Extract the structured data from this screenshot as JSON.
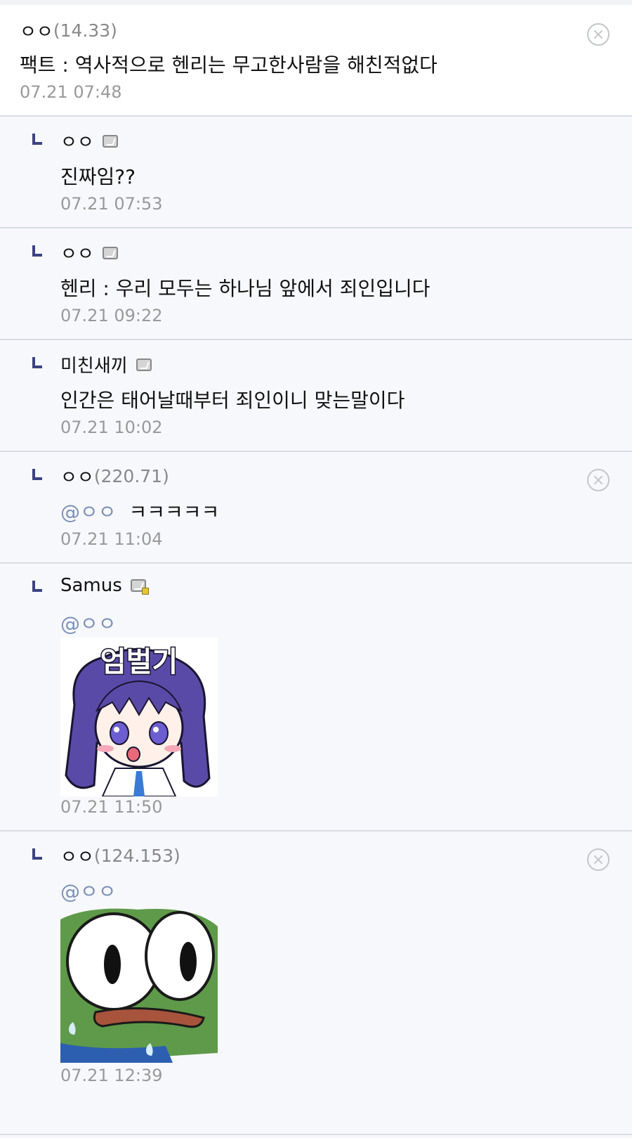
{
  "comments": [
    {
      "nick": "ㅇㅇ",
      "ip": "(14.33)",
      "text": "팩트 : 역사적으로 헨리는 무고한사람을 해친적없다",
      "date": "07.21 07:48"
    },
    {
      "nick": "ㅇㅇ",
      "text": "진짜임??",
      "date": "07.21 07:53"
    },
    {
      "nick": "ㅇㅇ",
      "text": "헨리 : 우리 모두는 하나님 앞에서 죄인입니다",
      "date": "07.21 09:22"
    },
    {
      "nick": "미친새끼",
      "text": "인간은 태어날때부터 죄인이니 맞는말이다",
      "date": "07.21 10:02"
    },
    {
      "nick": "ㅇㅇ",
      "ip": "(220.71)",
      "mention": "@ㅇㅇ",
      "text": "ㅋㅋㅋㅋㅋ",
      "date": "07.21 11:04"
    },
    {
      "nick": "Samus",
      "mention": "@ㅇㅇ",
      "sticker": "엄벌기",
      "date": "07.21 11:50"
    },
    {
      "nick": "ㅇㅇ",
      "ip": "(124.153)",
      "mention": "@ㅇㅇ",
      "date": "07.21 12:39"
    }
  ],
  "icons": {
    "reply": "reply-arrow-icon",
    "fixed_nick": "fixed-nick-icon",
    "half_fixed_nick": "half-fixed-nick-icon",
    "delete": "delete-icon",
    "anime_sticker": "anime-girl-sticker",
    "frog_sticker": "frog-sticker"
  },
  "colors": {
    "reply_mark": "#3d4380",
    "mention": "#7b90b8",
    "date": "#999999",
    "ip": "#888888",
    "root_bg": "#ffffff",
    "reply_bg": "#f7f8fb"
  }
}
